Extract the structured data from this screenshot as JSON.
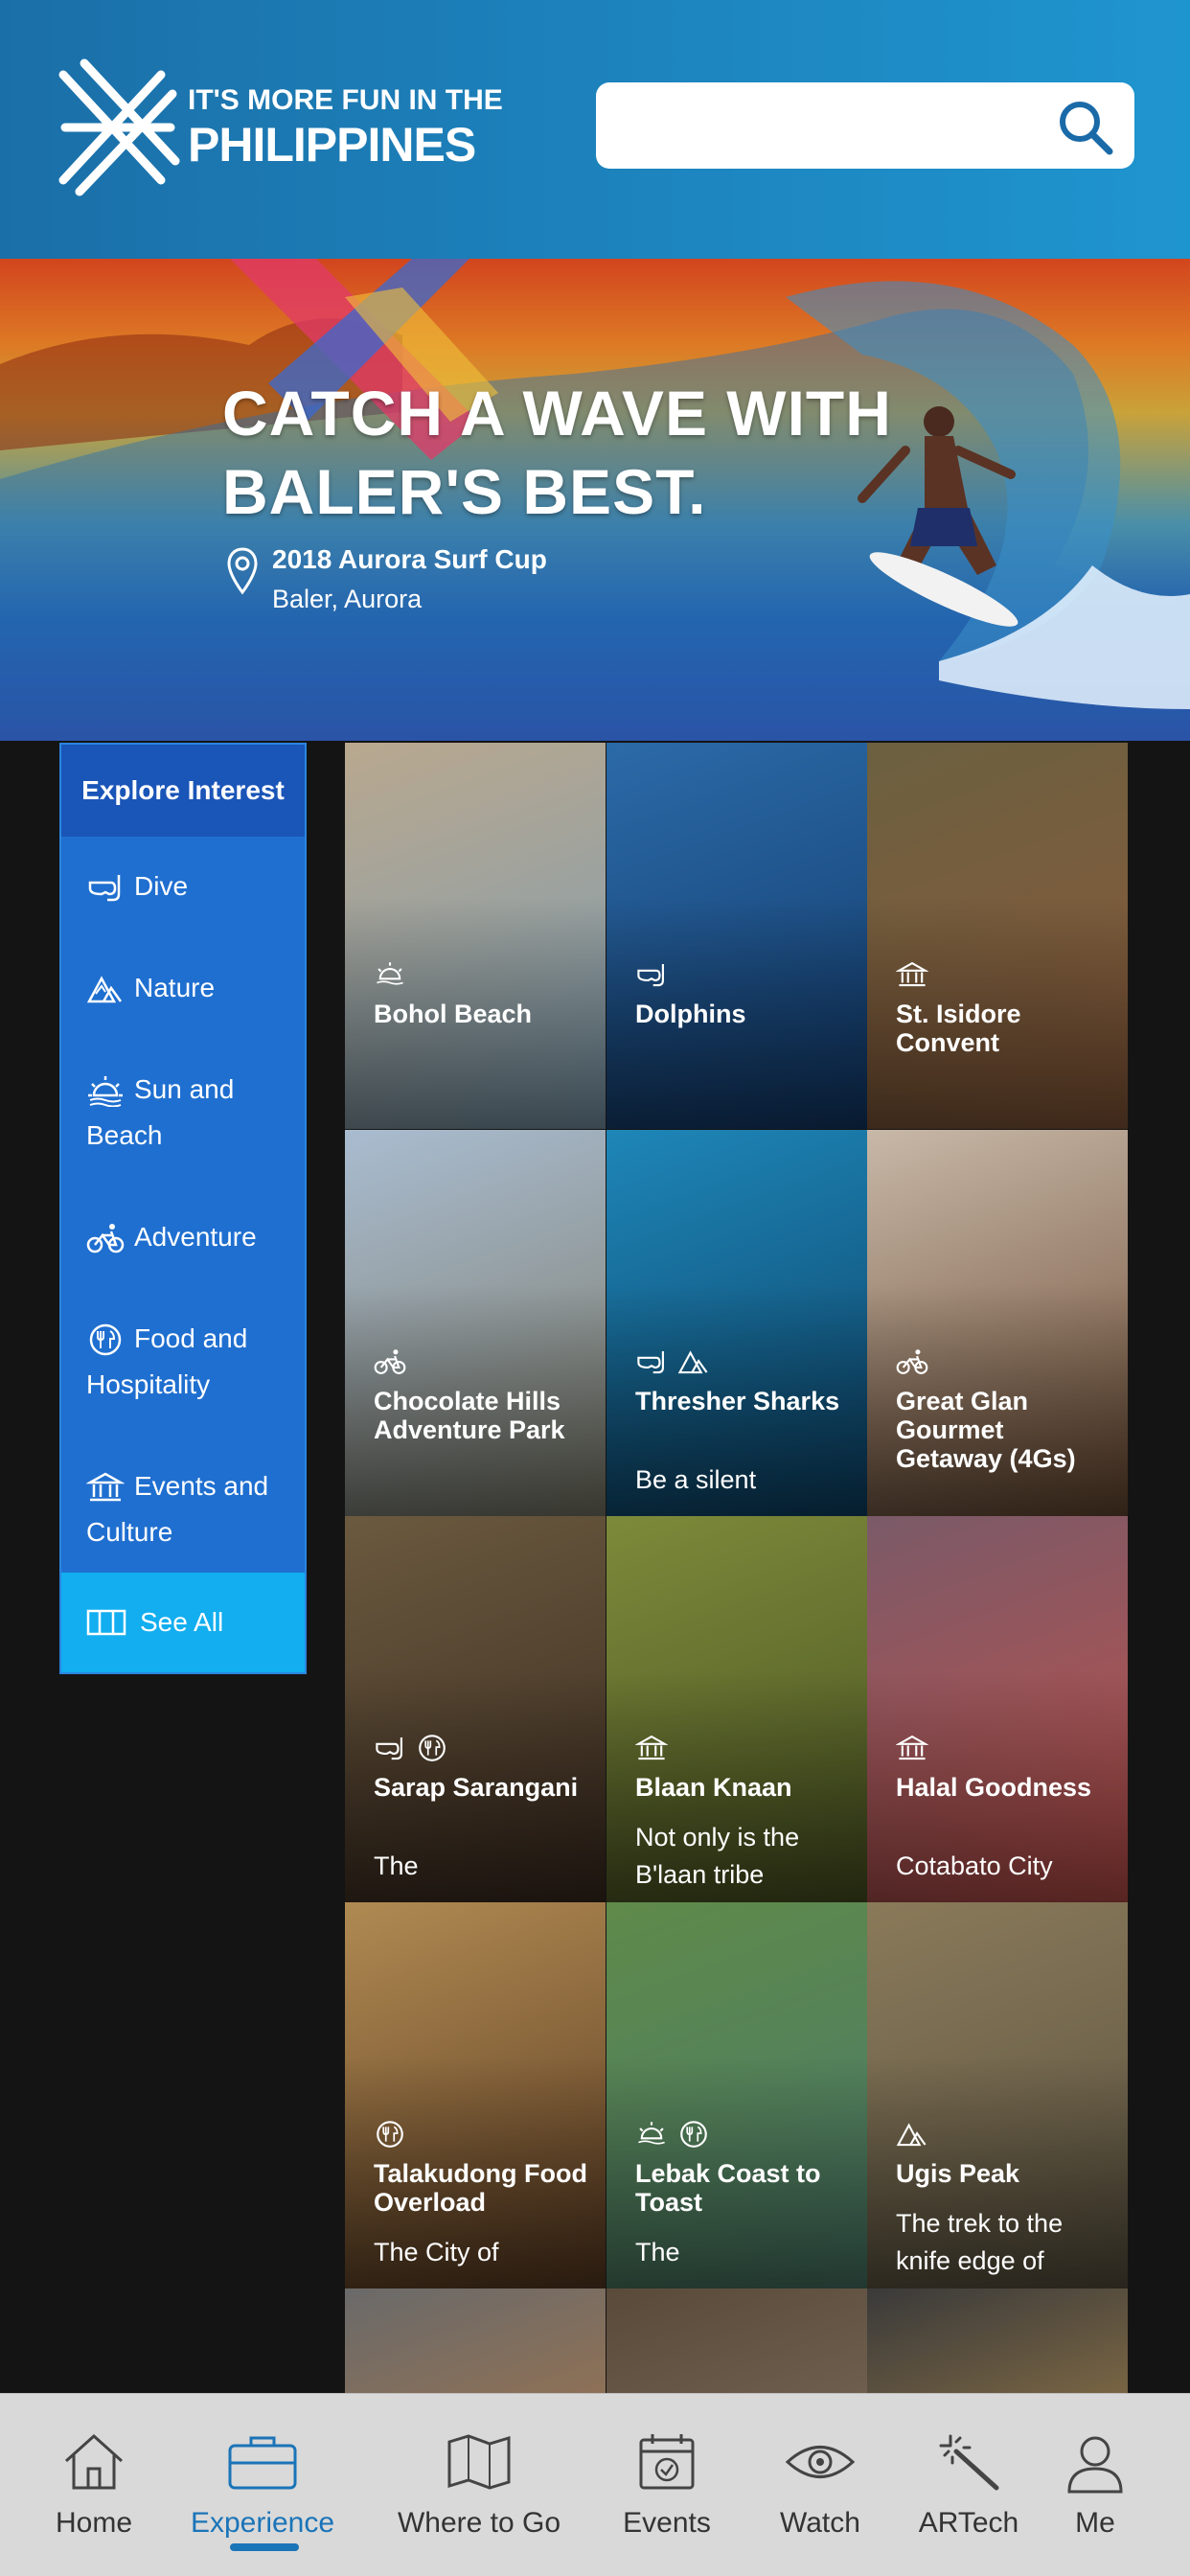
{
  "header": {
    "logo_line1": "IT'S MORE FUN IN THE",
    "logo_line2": "PHILIPPINES",
    "search_placeholder": ""
  },
  "hero": {
    "title_line1": "CATCH A WAVE WITH",
    "title_line2": "BALER'S BEST.",
    "event_name": "2018 Aurora Surf Cup",
    "location": "Baler, Aurora"
  },
  "sidebar": {
    "heading": "Explore Interest",
    "items": [
      {
        "label": "Dive",
        "icon": "dive-mask-icon"
      },
      {
        "label": "Nature",
        "icon": "mountain-icon"
      },
      {
        "label": "Sun and Beach",
        "icon": "sun-icon"
      },
      {
        "label": "Adventure",
        "icon": "bicycle-icon"
      },
      {
        "label": "Food and Hospitality",
        "icon": "food-icon"
      },
      {
        "label": "Events and Culture",
        "icon": "museum-icon"
      }
    ],
    "see_all": "See All"
  },
  "tiles": [
    {
      "name": "Bohol Beach",
      "desc": "",
      "icons": [
        "sun-icon"
      ],
      "colors": [
        "#b9a88f",
        "#7d9cb0"
      ]
    },
    {
      "name": "Dolphins",
      "desc": "",
      "icons": [
        "dive-mask-icon"
      ],
      "colors": [
        "#2b6aa8",
        "#123a6a"
      ]
    },
    {
      "name": "St. Isidore Convent",
      "desc": "",
      "icons": [
        "museum-icon"
      ],
      "colors": [
        "#6b6040",
        "#8a5a3a"
      ]
    },
    {
      "name": "Chocolate Hills Adventure Park",
      "desc": "",
      "icons": [
        "bicycle-icon"
      ],
      "colors": [
        "#a9bcd0",
        "#7b7a6a"
      ]
    },
    {
      "name": "Thresher Sharks",
      "desc": "Be a silent",
      "icons": [
        "dive-mask-icon",
        "mountain-icon"
      ],
      "colors": [
        "#1e86b8",
        "#0d4266"
      ]
    },
    {
      "name": "Great Glan Gourmet Getaway (4Gs)",
      "desc": "",
      "icons": [
        "bicycle-icon"
      ],
      "colors": [
        "#c8b8a8",
        "#6a4a32"
      ]
    },
    {
      "name": "Sarap Sarangani",
      "desc": "The",
      "icons": [
        "dive-mask-icon",
        "food-icon"
      ],
      "colors": [
        "#6b5a3f",
        "#3a2a1f"
      ]
    },
    {
      "name": "Blaan Knaan",
      "desc": "Not only is the B'laan tribe",
      "icons": [
        "museum-icon"
      ],
      "colors": [
        "#7d8a3a",
        "#4a5322"
      ]
    },
    {
      "name": "Halal Goodness",
      "desc": "Cotabato City",
      "icons": [
        "museum-icon"
      ],
      "colors": [
        "#7a5a68",
        "#c0504a"
      ]
    },
    {
      "name": "Talakudong Food Overload",
      "desc": "The City of",
      "icons": [
        "food-icon"
      ],
      "colors": [
        "#b08a52",
        "#5a3b22"
      ]
    },
    {
      "name": "Lebak Coast to Toast",
      "desc": "The",
      "icons": [
        "sun-icon",
        "food-icon"
      ],
      "colors": [
        "#5f8a4a",
        "#4a7a6a"
      ]
    },
    {
      "name": "Ugis Peak",
      "desc": "The trek to the knife edge of",
      "icons": [
        "mountain-icon"
      ],
      "colors": [
        "#8a7a5a",
        "#5a5240"
      ]
    },
    {
      "name": "",
      "desc": "",
      "icons": [],
      "colors": [
        "#6a6a6a",
        "#c07a3a"
      ]
    },
    {
      "name": "",
      "desc": "",
      "icons": [],
      "colors": [
        "#5a4a3a",
        "#8a7a6a"
      ]
    },
    {
      "name": "",
      "desc": "",
      "icons": [],
      "colors": [
        "#3a3a3a",
        "#d0a050"
      ]
    }
  ],
  "nav": {
    "tabs": [
      {
        "label": "Home",
        "icon": "home-icon",
        "active": false
      },
      {
        "label": "Experience",
        "icon": "briefcase-icon",
        "active": true
      },
      {
        "label": "Where to Go",
        "icon": "map-icon",
        "active": false
      },
      {
        "label": "Events",
        "icon": "calendar-icon",
        "active": false
      },
      {
        "label": "Watch",
        "icon": "eye-icon",
        "active": false
      },
      {
        "label": "ARTech",
        "icon": "magic-wand-icon",
        "active": false
      },
      {
        "label": "Me",
        "icon": "user-icon",
        "active": false
      }
    ]
  }
}
